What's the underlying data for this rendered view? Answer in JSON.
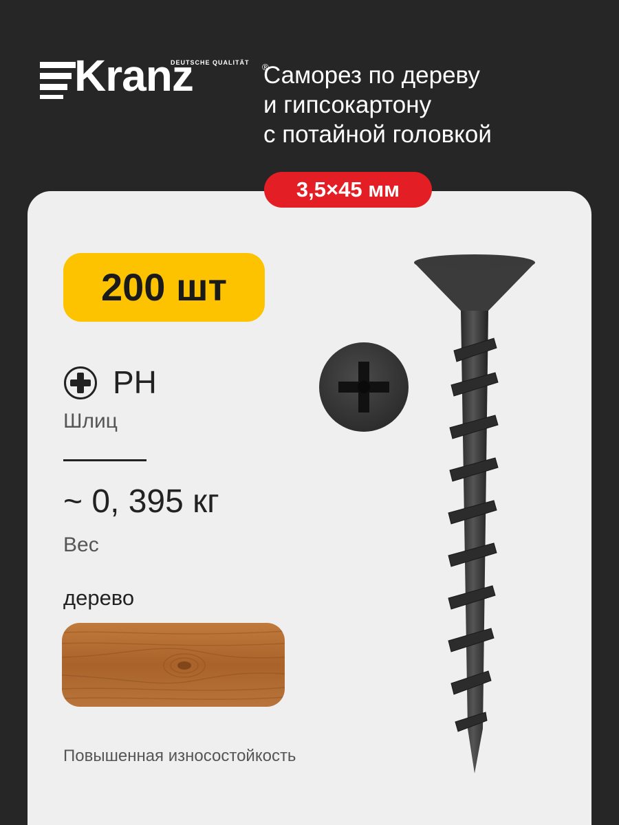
{
  "brand": {
    "name": "Kranz",
    "tagline": "DEUTSCHE QUALITÄT",
    "registered_mark": "®"
  },
  "product": {
    "title_lines": [
      "Саморез по дереву",
      "и гипсокартону",
      "с потайной головкой"
    ],
    "size": "3,5×45 мм",
    "quantity": "200 шт"
  },
  "specs": {
    "slot_value": "PH",
    "slot_caption": "Шлиц",
    "weight_value": "~ 0, 395 кг",
    "weight_caption": "Вес",
    "material_label": "дерево",
    "feature": "Повышенная износостойкость"
  },
  "icons": {
    "slot": "phillips-plus-icon",
    "screw": "screw-image",
    "screw_head": "screw-head-image",
    "wood": "wood-swatch-image"
  },
  "colors": {
    "background": "#262626",
    "card": "#efefef",
    "size_badge": "#e31e24",
    "quantity_badge": "#fdc300",
    "wood": "#b06a2e"
  }
}
